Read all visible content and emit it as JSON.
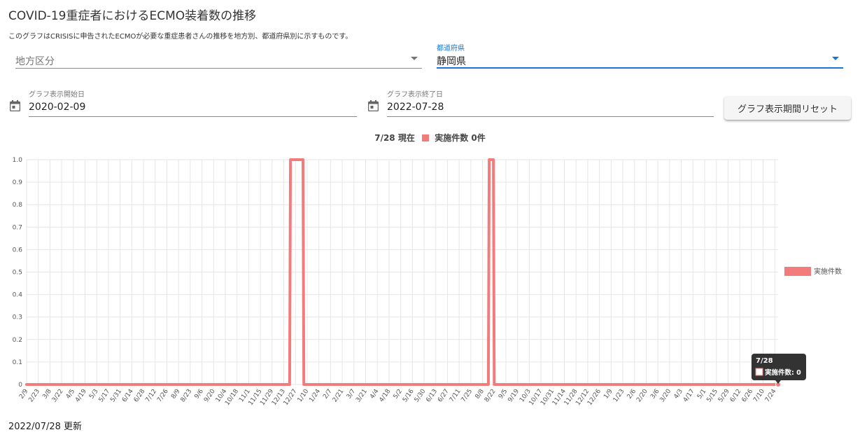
{
  "page": {
    "title": "COVID-19重症者におけるECMO装着数の推移",
    "description": "このグラフはCRISISに申告されたECMOが必要な重症患者さんの推移を地方別、都道府県別に示すものです。",
    "updated": "2022/07/28 更新"
  },
  "filters": {
    "region": {
      "placeholder": "地方区分",
      "value": ""
    },
    "prefecture": {
      "label": "都道府県",
      "value": "静岡県"
    },
    "start_date": {
      "label": "グラフ表示開始日",
      "value": "2020-02-09"
    },
    "end_date": {
      "label": "グラフ表示終了日",
      "value": "2022-07-28"
    },
    "reset_button": "グラフ表示期間リセット"
  },
  "summary": {
    "date": "7/28 現在",
    "series_label": "実施件数",
    "value_text": "0件"
  },
  "tooltip": {
    "title": "7/28",
    "label": "実施件数: 0"
  },
  "colors": {
    "series": "#f47b7b",
    "accent": "#1976d2",
    "grid": "#e6e6e6"
  },
  "icons": {
    "dropdown": "caret-down-icon",
    "calendar": "calendar-icon"
  },
  "chart_data": {
    "type": "line",
    "series": [
      {
        "name": "実施件数",
        "segments": [
          {
            "from": "2020-02-09",
            "to": "2020-12-20",
            "value": 0
          },
          {
            "from": "2020-12-21",
            "to": "2021-01-05",
            "value": 1
          },
          {
            "from": "2021-01-06",
            "to": "2021-08-15",
            "value": 0
          },
          {
            "from": "2021-08-16",
            "to": "2021-08-21",
            "value": 1
          },
          {
            "from": "2021-08-22",
            "to": "2022-07-28",
            "value": 0
          }
        ]
      }
    ],
    "ylim": [
      0,
      1.0
    ],
    "y_ticks": [
      "0",
      "0.1",
      "0.2",
      "0.3",
      "0.4",
      "0.5",
      "0.6",
      "0.7",
      "0.8",
      "0.9",
      "1.0"
    ],
    "x_ticks": [
      "2/9",
      "2/23",
      "3/8",
      "3/22",
      "4/5",
      "4/19",
      "5/3",
      "5/17",
      "5/31",
      "6/14",
      "6/28",
      "7/12",
      "7/26",
      "8/9",
      "8/23",
      "9/6",
      "9/20",
      "10/4",
      "10/18",
      "11/1",
      "11/15",
      "11/29",
      "12/13",
      "12/27",
      "1/10",
      "1/24",
      "2/7",
      "2/21",
      "3/7",
      "3/21",
      "4/4",
      "4/18",
      "5/2",
      "5/16",
      "5/30",
      "6/13",
      "6/27",
      "7/11",
      "7/25",
      "8/8",
      "8/22",
      "9/5",
      "9/19",
      "10/3",
      "10/17",
      "10/31",
      "11/14",
      "11/28",
      "12/12",
      "12/26",
      "1/9",
      "1/23",
      "2/6",
      "2/20",
      "3/6",
      "3/20",
      "4/3",
      "4/17",
      "5/1",
      "5/15",
      "5/29",
      "6/12",
      "6/26",
      "7/10",
      "7/24"
    ],
    "grid": true,
    "legend_position": "right"
  }
}
